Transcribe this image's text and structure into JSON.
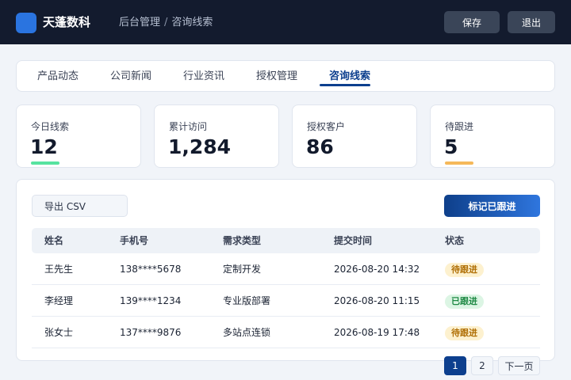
{
  "header": {
    "brand": "天蓬数科",
    "breadcrumb": [
      "后台管理",
      "咨询线索"
    ],
    "breadcrumb_sep": "/",
    "save_label": "保存",
    "logout_label": "退出"
  },
  "tabs": [
    {
      "label": "产品动态",
      "active": false
    },
    {
      "label": "公司新闻",
      "active": false
    },
    {
      "label": "行业资讯",
      "active": false
    },
    {
      "label": "授权管理",
      "active": false
    },
    {
      "label": "咨询线索",
      "active": true
    }
  ],
  "stats": [
    {
      "label": "今日线索",
      "value": "12",
      "color": "#57e3a0"
    },
    {
      "label": "累计访问",
      "value": "1,284",
      "color": ""
    },
    {
      "label": "授权客户",
      "value": "86",
      "color": ""
    },
    {
      "label": "待跟进",
      "value": "5",
      "color": "#f5b85a"
    }
  ],
  "toolbar": {
    "export_label": "导出 CSV",
    "mark_label": "标记已跟进"
  },
  "table": {
    "columns": [
      "姓名",
      "手机号",
      "需求类型",
      "提交时间",
      "状态"
    ],
    "rows": [
      {
        "name": "王先生",
        "phone": "138****5678",
        "type": "定制开发",
        "time": "2026-08-20 14:32",
        "status": "待跟进",
        "status_kind": "pending"
      },
      {
        "name": "李经理",
        "phone": "139****1234",
        "type": "专业版部署",
        "time": "2026-08-20 11:15",
        "status": "已跟进",
        "status_kind": "done"
      },
      {
        "name": "张女士",
        "phone": "137****9876",
        "type": "多站点连锁",
        "time": "2026-08-19 17:48",
        "status": "待跟进",
        "status_kind": "pending"
      }
    ]
  },
  "pagination": {
    "page_1": "1",
    "page_2": "2",
    "next_label": "下一页"
  },
  "colors": {
    "accent": "#0d3f8e",
    "topbar": "#131b2e",
    "pending": "#b06f05",
    "done": "#1f8a45"
  }
}
